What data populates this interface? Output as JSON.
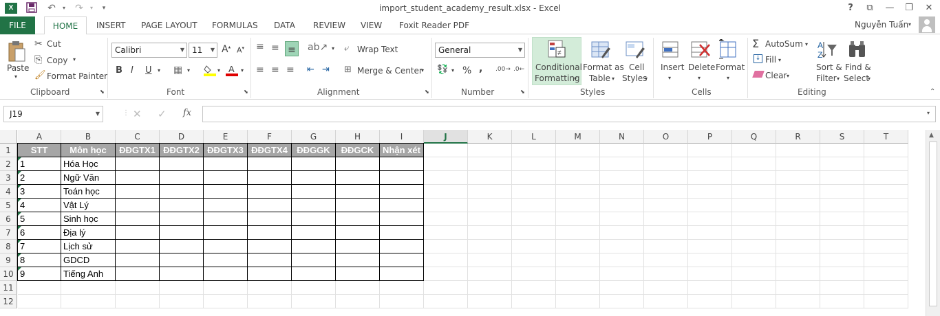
{
  "window": {
    "title": "import_student_academy_result.xlsx - Excel"
  },
  "titlebar": {
    "help": "?",
    "ribbon_opts": "⧉",
    "minimize": "—",
    "restore": "❐",
    "close": "✕"
  },
  "tabs": [
    "FILE",
    "HOME",
    "INSERT",
    "PAGE LAYOUT",
    "FORMULAS",
    "DATA",
    "REVIEW",
    "VIEW",
    "Foxit Reader PDF"
  ],
  "user": "Nguyễn Tuấn",
  "clipboard": {
    "paste": "Paste",
    "cut": "Cut",
    "copy": "Copy",
    "format_painter": "Format Painter",
    "label": "Clipboard"
  },
  "font": {
    "name": "Calibri",
    "size": "11",
    "bold": "B",
    "italic": "I",
    "underline": "U",
    "label": "Font"
  },
  "alignment": {
    "wrap": "Wrap Text",
    "merge": "Merge & Center",
    "label": "Alignment"
  },
  "number": {
    "format": "General",
    "percent": "%",
    "comma": ",",
    "label": "Number"
  },
  "styles": {
    "cond1": "Conditional",
    "cond2": "Formatting",
    "fmt1": "Format as",
    "fmt2": "Table",
    "cell1": "Cell",
    "cell2": "Styles",
    "label": "Styles"
  },
  "cells": {
    "insert": "Insert",
    "delete": "Delete",
    "format": "Format",
    "label": "Cells"
  },
  "editing": {
    "autosum": "AutoSum",
    "fill": "Fill",
    "clear": "Clear",
    "sort1": "Sort &",
    "sort2": "Filter",
    "find1": "Find &",
    "find2": "Select",
    "label": "Editing"
  },
  "formula_bar": {
    "name_box": "J19",
    "value": ""
  },
  "columns": [
    "A",
    "B",
    "C",
    "D",
    "E",
    "F",
    "G",
    "H",
    "I",
    "J",
    "K",
    "L",
    "M",
    "N",
    "O",
    "P",
    "Q",
    "R",
    "S",
    "T"
  ],
  "selected_column": "J",
  "rows": [
    "1",
    "2",
    "3",
    "4",
    "5",
    "6",
    "7",
    "8",
    "9",
    "10",
    "11",
    "12"
  ],
  "headers": [
    "STT",
    "Môn học",
    "ĐĐGTX1",
    "ĐĐGTX2",
    "ĐĐGTX3",
    "ĐĐGTX4",
    "ĐĐGGK",
    "ĐĐGCK",
    "Nhận xét"
  ],
  "data": [
    [
      "1",
      "Hóa Học"
    ],
    [
      "2",
      "Ngữ Văn"
    ],
    [
      "3",
      "Toán học"
    ],
    [
      "4",
      "Vật Lý"
    ],
    [
      "5",
      "Sinh học"
    ],
    [
      "6",
      "Địa lý"
    ],
    [
      "7",
      "Lịch sử"
    ],
    [
      "8",
      "GDCD"
    ],
    [
      "9",
      "Tiếng Anh"
    ]
  ],
  "colors": {
    "accent": "#217346",
    "header_fill": "#a6a6a6"
  }
}
